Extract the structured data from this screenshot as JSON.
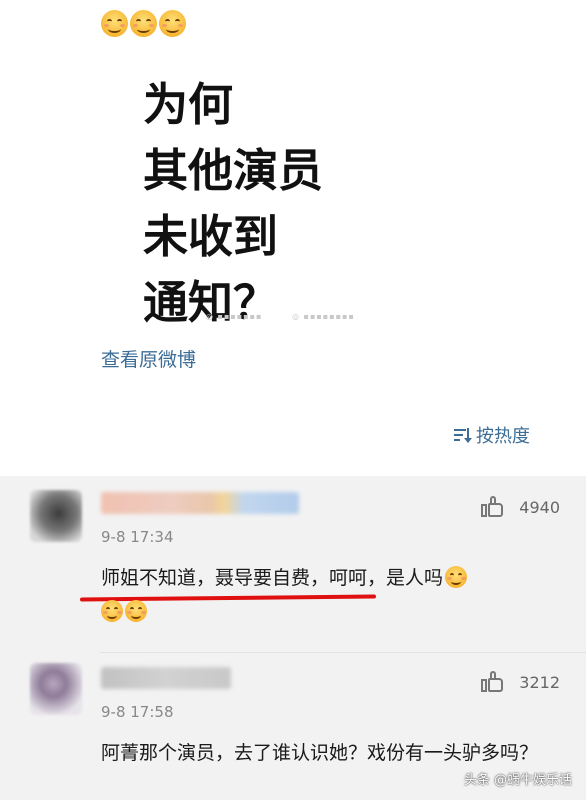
{
  "post": {
    "emoji_count": 3,
    "emoji_icon": "smiling-face-icon",
    "headline_lines": [
      "为何",
      "其他演员",
      "未收到",
      "通知？"
    ],
    "view_original_label": "查看原微博",
    "sort_label": "按热度",
    "sort_icon": "sort-descending-icon"
  },
  "comments": [
    {
      "time": "9-8 17:34",
      "likes": "4940",
      "text": "师姐不知道，聂导要自费，呵呵，是人吗",
      "underline_color": "#e01010"
    },
    {
      "time": "9-8 17:58",
      "likes": "3212",
      "text": "阿菁那个演员，去了谁认识她？戏份有一头驴多吗？"
    }
  ],
  "colors": {
    "link": "#3c6d97",
    "comment_bg": "#f2f2f2",
    "meta_text": "#888888"
  },
  "footer": {
    "watermark": "头条 @蜗牛娱乐话"
  }
}
